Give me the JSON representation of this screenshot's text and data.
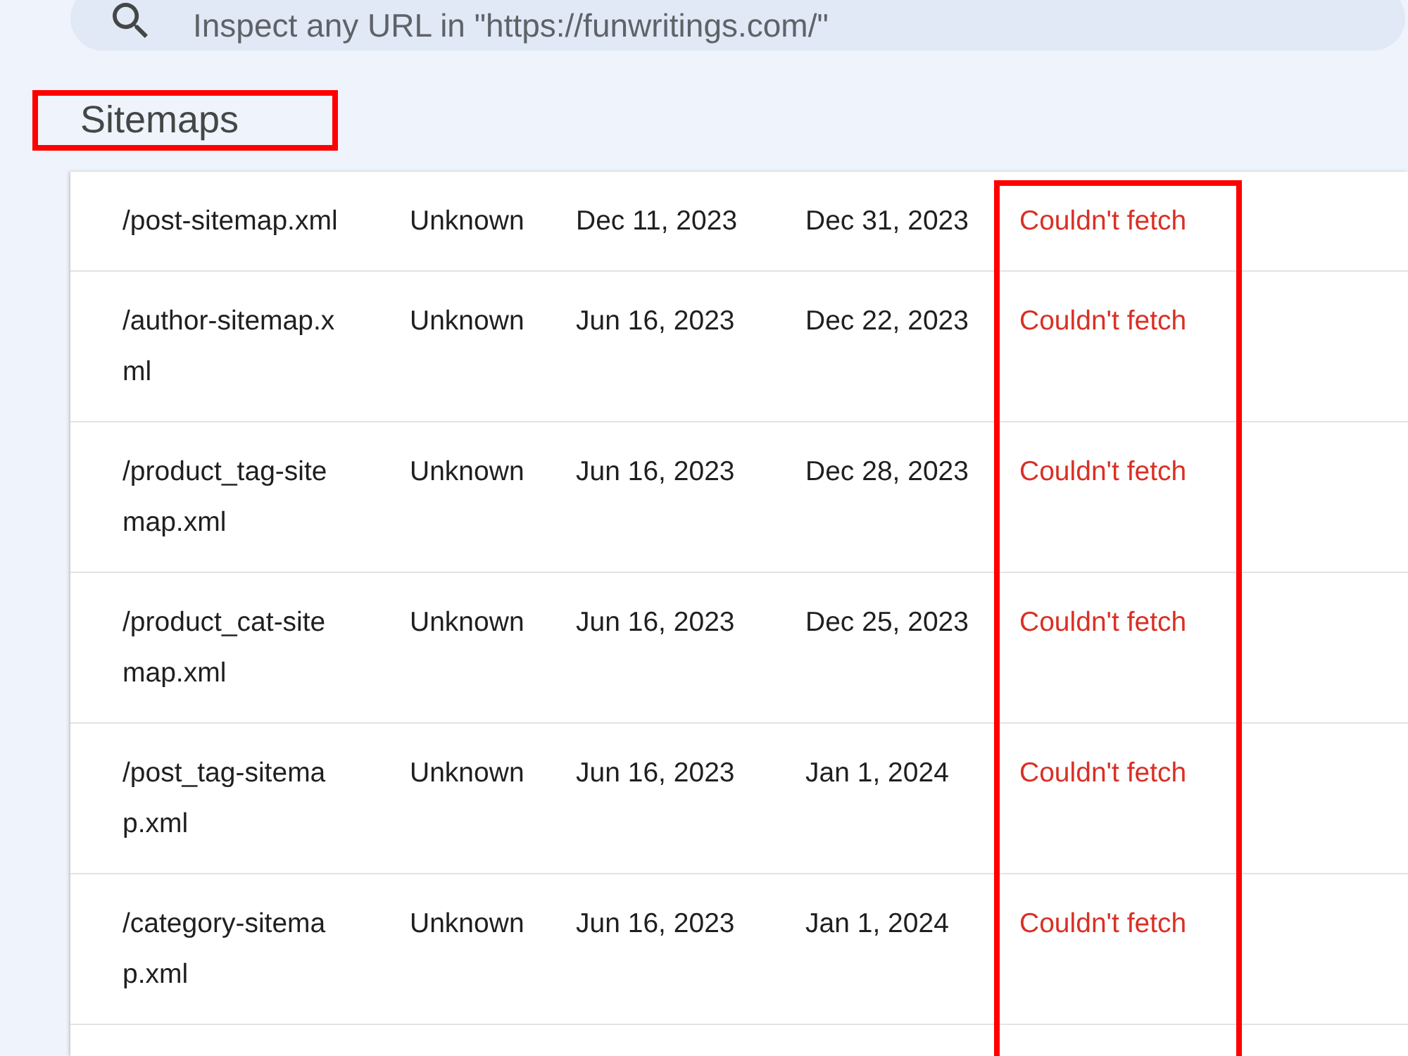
{
  "search": {
    "placeholder": "Inspect any URL in \"https://funwritings.com/\""
  },
  "section": {
    "title": "Sitemaps",
    "marked": true
  },
  "table": {
    "column_5_marked": true,
    "rows": [
      {
        "cells": [
          "/post-sitemap.xml",
          "Unknown",
          "Dec 11, 2023",
          "Dec 31, 2023",
          "Couldn't fetch"
        ]
      },
      {
        "cells": [
          "/author-sitemap.xml",
          "Unknown",
          "Jun 16, 2023",
          "Dec 22, 2023",
          "Couldn't fetch"
        ]
      },
      {
        "cells": [
          "/product_tag-sitemap.xml",
          "Unknown",
          "Jun 16, 2023",
          "Dec 28, 2023",
          "Couldn't fetch"
        ]
      },
      {
        "cells": [
          "/product_cat-sitemap.xml",
          "Unknown",
          "Jun 16, 2023",
          "Dec 25, 2023",
          "Couldn't fetch"
        ]
      },
      {
        "cells": [
          "/post_tag-sitemap.xml",
          "Unknown",
          "Jun 16, 2023",
          "Jan 1, 2024",
          "Couldn't fetch"
        ]
      },
      {
        "cells": [
          "/category-sitemap.xml",
          "Unknown",
          "Jun 16, 2023",
          "Jan 1, 2024",
          "Couldn't fetch"
        ]
      }
    ]
  }
}
